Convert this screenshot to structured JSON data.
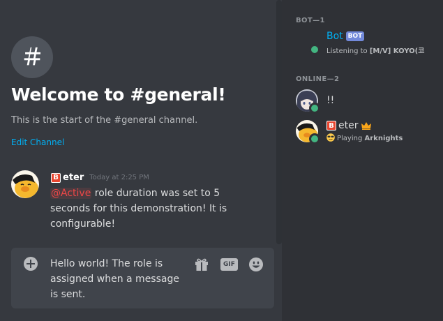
{
  "channel": {
    "welcome_title": "Welcome to #general!",
    "start_text": "This is the start of the #general channel.",
    "edit_label": "Edit Channel",
    "icon": "hash-icon"
  },
  "message": {
    "badge": "B",
    "author": "eter",
    "timestamp": "Today at 2:25 PM",
    "mention": "@Active",
    "text": " role duration was set to 5 seconds for this demonstration! It is configurable!"
  },
  "composer": {
    "text": "Hello world! The role is assigned when a message is sent.",
    "gif_label": "GIF"
  },
  "members": {
    "bot_header": "BOT—1",
    "online_header": "ONLINE—2",
    "bot": {
      "name": "Bot",
      "tag": "BOT",
      "activity_prefix": "Listening to ",
      "activity_bold": "[M/V] KOYO(코"
    },
    "user1": {
      "name": "!!"
    },
    "user2": {
      "badge": "B",
      "name": "eter",
      "activity_prefix": "Playing ",
      "activity_bold": "Arknights"
    }
  },
  "colors": {
    "background": "#36393f",
    "sidebar": "#2f3136",
    "online": "#43b581",
    "bot_name": "#00b0f4",
    "mention": "#f04747",
    "link": "#00b0f4"
  }
}
